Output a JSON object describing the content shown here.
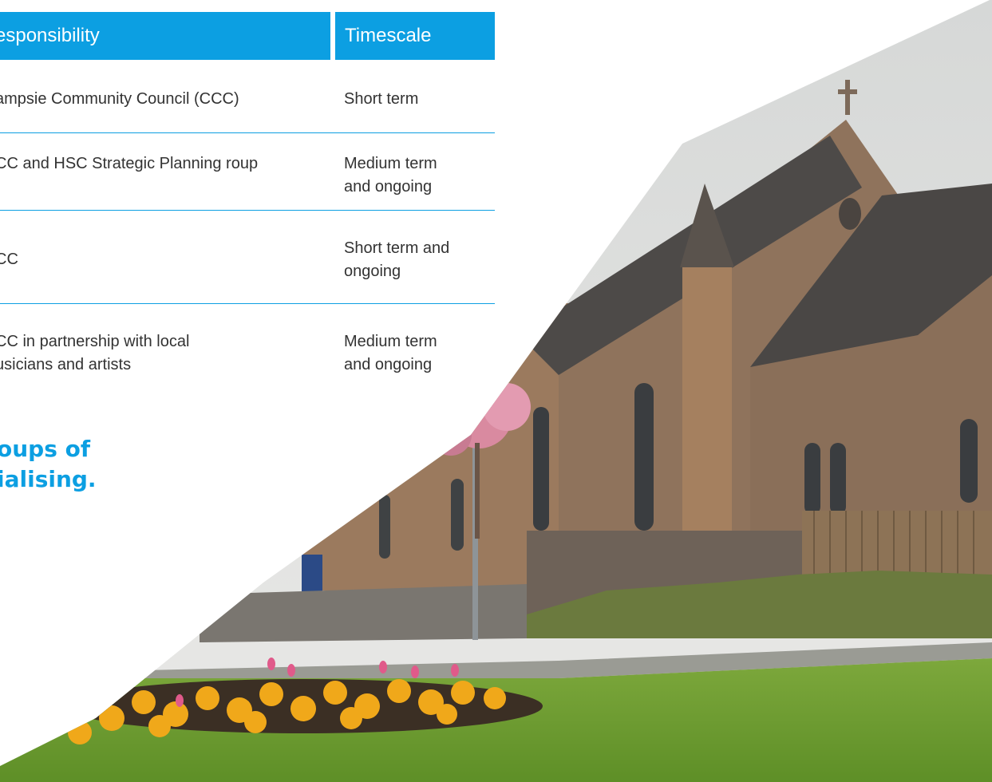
{
  "table": {
    "headers": {
      "responsibility": "esponsibility",
      "timescale": "Timescale"
    },
    "rows": [
      {
        "responsibility": "ampsie Community Council (CCC)",
        "timescale": "Short term"
      },
      {
        "responsibility": "CC and HSC Strategic Planning roup",
        "timescale": "Medium term and ongoing"
      },
      {
        "responsibility": "CC",
        "timescale": "Short term and ongoing"
      },
      {
        "responsibility": "CC in partnership with local usicians and artists",
        "timescale": "Medium term and ongoing"
      }
    ]
  },
  "pull_quote": {
    "line1": "oups of",
    "line2": "ialising."
  },
  "photo": {
    "subject": "church"
  },
  "colors": {
    "accent": "#0c9fe2",
    "text": "#333333",
    "background": "#ffffff"
  }
}
